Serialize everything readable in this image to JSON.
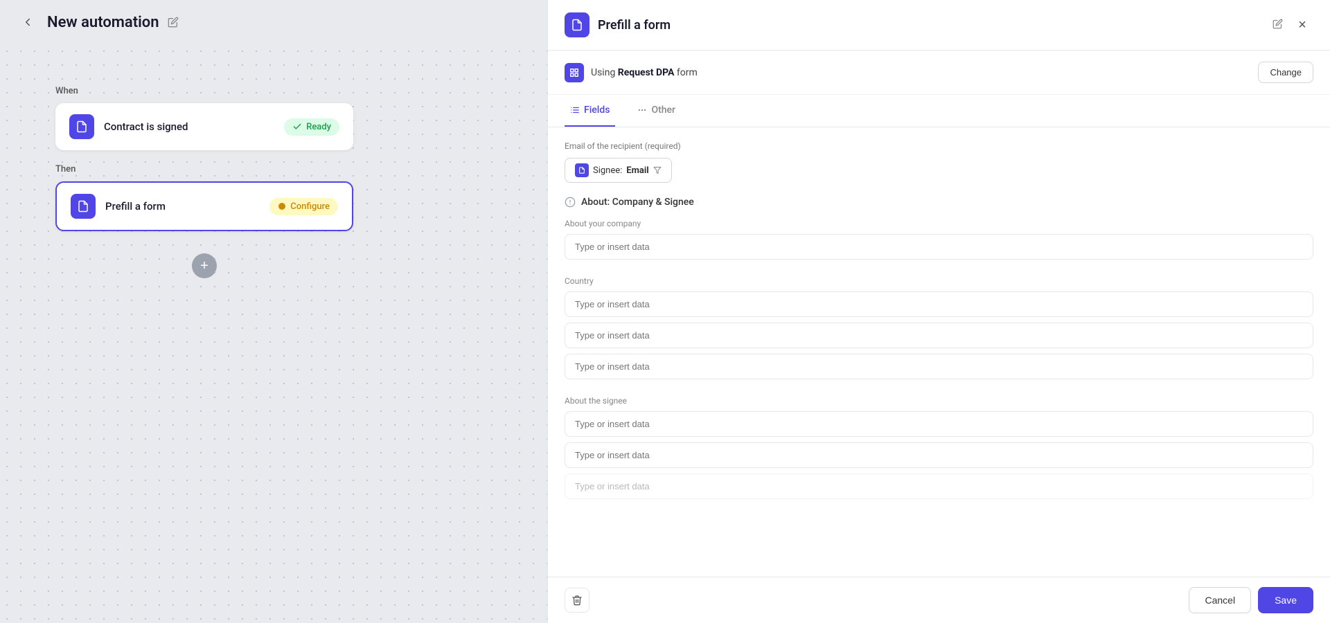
{
  "header": {
    "title": "New automation",
    "back_label": "←",
    "edit_tooltip": "Edit name"
  },
  "canvas": {
    "when_label": "When",
    "then_label": "Then",
    "card_when": {
      "title": "Contract is signed",
      "status": "Ready"
    },
    "card_then": {
      "title": "Prefill a form",
      "status": "Configure"
    },
    "add_button_label": "+"
  },
  "panel": {
    "title": "Prefill a form",
    "using_prefix": "Using ",
    "form_name": "Request DPA",
    "using_suffix": " form",
    "change_label": "Change",
    "close_label": "×",
    "tabs": [
      {
        "id": "fields",
        "label": "Fields",
        "active": true
      },
      {
        "id": "other",
        "label": "Other",
        "active": false
      }
    ],
    "email_field_label": "Email of the recipient (required)",
    "signee_label": "Signee:",
    "signee_value": "Email",
    "section_title": "About: Company & Signee",
    "company_section_label": "About your company",
    "country_label": "Country",
    "signee_section_label": "About the signee",
    "input_placeholder": "Type or insert data",
    "inputs_company": [
      "Type or insert data",
      "Type or insert data",
      "Type or insert data",
      "Type or insert data"
    ],
    "inputs_signee": [
      "Type or insert data",
      "Type or insert data",
      "Type or insert data"
    ],
    "cancel_label": "Cancel",
    "save_label": "Save"
  }
}
